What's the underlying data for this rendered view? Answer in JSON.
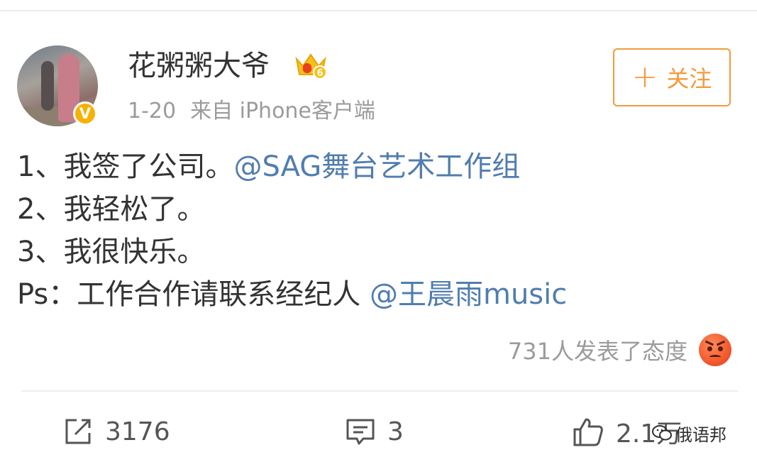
{
  "post": {
    "author": {
      "name": "花粥粥大爷",
      "verified_mark": "V",
      "vip_level": "6"
    },
    "time": "1-20",
    "source": "来自 iPhone客户端",
    "follow_button": {
      "plus": "+",
      "label": "关注"
    },
    "content": {
      "line1_text": "1、我签了公司。",
      "line1_mention": "@SAG舞台艺术工作组",
      "line2_text": "2、我轻松了。",
      "line3_text": "3、我很快乐。",
      "line4_text": "Ps：工作合作请联系经纪人 ",
      "line4_mention": "@王晨雨music"
    },
    "reactions": {
      "summary": "731人发表了态度",
      "icon": "angry-face-icon"
    },
    "actions": {
      "repost_count": "3176",
      "comment_count": "3",
      "like_count": "2.1万"
    }
  },
  "watermark": {
    "text": "俄语邦"
  },
  "colors": {
    "accent": "#f39a3e",
    "mention": "#507daf",
    "text": "#333333",
    "muted": "#9b9b9b",
    "verified": "#f7b100"
  }
}
